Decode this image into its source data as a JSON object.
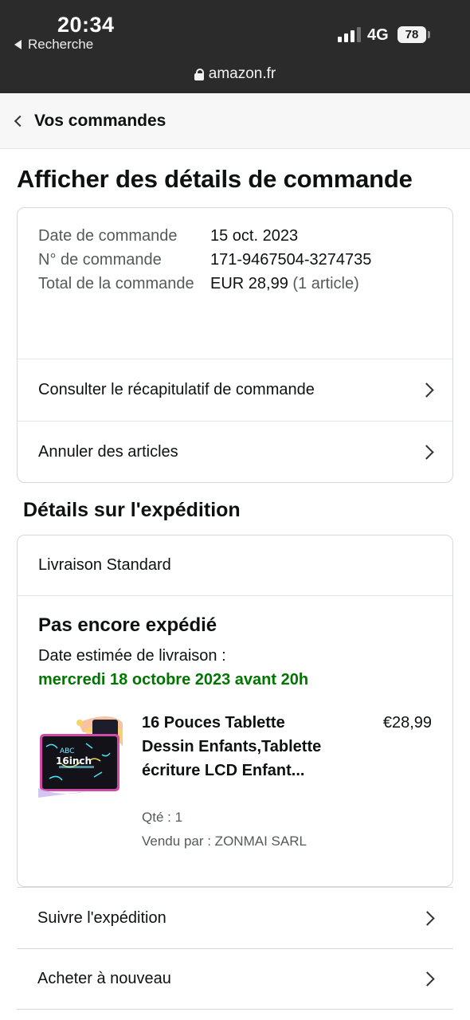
{
  "status_bar": {
    "time": "20:34",
    "back_app": "Recherche",
    "network": "4G",
    "battery": "78",
    "url": "amazon.fr"
  },
  "nav": {
    "back_label": "Vos commandes"
  },
  "page_title": "Afficher des détails de commande",
  "order_summary": {
    "date_label": "Date de commande",
    "date_value": "15 oct. 2023",
    "number_label": "N° de commande",
    "number_value": "171-9467504-3274735",
    "total_label": "Total de la commande",
    "total_value": "EUR 28,99",
    "total_count": "(1 article)"
  },
  "order_links": [
    {
      "label": "Consulter le récapitulatif de commande"
    },
    {
      "label": "Annuler des articles"
    }
  ],
  "shipment": {
    "section_title": "Détails sur l'expédition",
    "method": "Livraison Standard",
    "status": "Pas encore expédié",
    "eta_label": "Date estimée de livraison :",
    "eta_value": "mercredi 18 octobre 2023 avant 20h",
    "item": {
      "title": "16 Pouces Tablette Dessin Enfants,Tablette écriture LCD Enfant...",
      "price": "€28,99",
      "qty": "Qté : 1",
      "seller": "Vendu par : ZONMAI SARL",
      "thumb_text": "ABC 16inch"
    }
  },
  "actions": [
    {
      "label": "Suivre l'expédition"
    },
    {
      "label": "Acheter à nouveau"
    }
  ],
  "colors": {
    "status_bar_bg": "#2b2b2b",
    "eta_green": "#007600",
    "border": "#d5d9d9"
  }
}
